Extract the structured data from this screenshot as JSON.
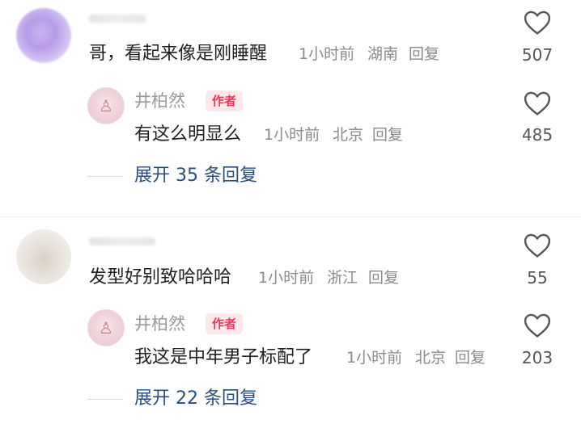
{
  "comments": [
    {
      "text": "哥，看起来像是刚睡醒",
      "time": "1小时前",
      "location": "湖南",
      "reply_label": "回复",
      "likes": "507",
      "reply": {
        "author": "井柏然",
        "badge": "作者",
        "text": "有这么明显么",
        "time": "1小时前",
        "location": "北京",
        "reply_label": "回复",
        "likes": "485"
      },
      "expand": "展开 35 条回复"
    },
    {
      "text": "发型好别致哈哈哈",
      "time": "1小时前",
      "location": "浙江",
      "reply_label": "回复",
      "likes": "55",
      "reply": {
        "author": "井柏然",
        "badge": "作者",
        "text": "我这是中年男子标配了",
        "time": "1小时前",
        "location": "北京",
        "reply_label": "回复",
        "likes": "203"
      },
      "expand": "展开 22 条回复"
    }
  ],
  "icons": {
    "like": "heart-outline-icon"
  },
  "colors": {
    "author_badge_bg": "#fbe7ec",
    "author_badge_text": "#e8395a",
    "expand_link": "#2b4d7c"
  }
}
